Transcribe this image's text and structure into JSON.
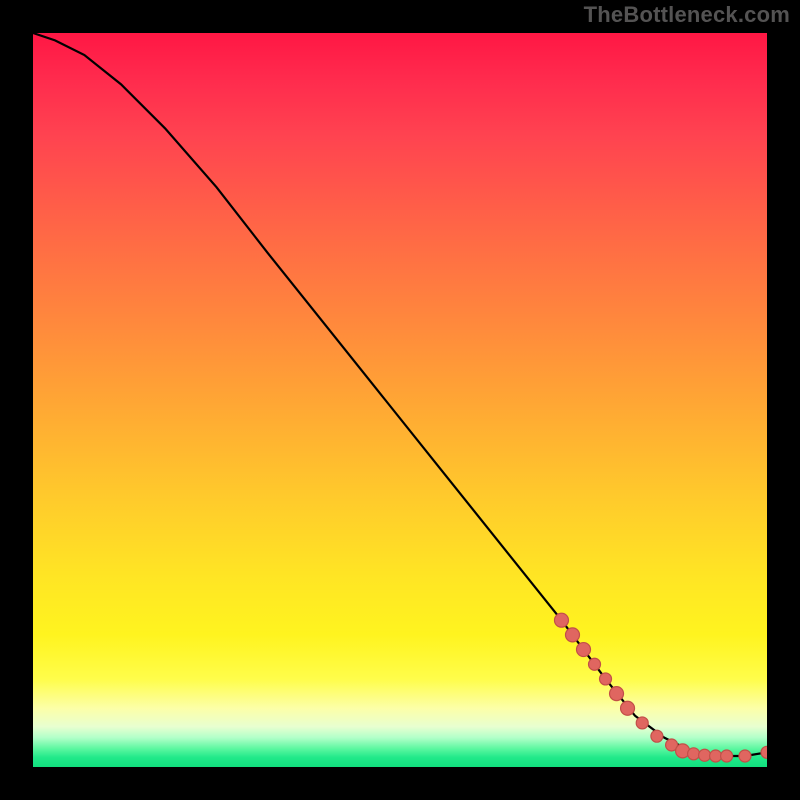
{
  "watermark": "TheBottleneck.com",
  "colors": {
    "background": "#000000",
    "curve": "#000000",
    "point_fill": "#e06660",
    "point_stroke": "#c24f48",
    "watermark": "#545353"
  },
  "chart_data": {
    "type": "line",
    "title": "",
    "xlabel": "",
    "ylabel": "",
    "xlim": [
      0,
      100
    ],
    "ylim": [
      0,
      100
    ],
    "series": [
      {
        "name": "bottleneck-curve",
        "x": [
          0,
          3,
          7,
          12,
          18,
          25,
          32,
          40,
          48,
          56,
          64,
          72,
          78,
          82,
          86,
          90,
          94,
          97,
          100
        ],
        "y": [
          100,
          99,
          97,
          93,
          87,
          79,
          70,
          60,
          50,
          40,
          30,
          20,
          12,
          7,
          4,
          2,
          1.5,
          1.5,
          2
        ]
      }
    ],
    "scatter": [
      {
        "name": "highlight-points",
        "points": [
          {
            "x": 72,
            "y": 20.0,
            "r": 7
          },
          {
            "x": 73.5,
            "y": 18.0,
            "r": 7
          },
          {
            "x": 75,
            "y": 16.0,
            "r": 7
          },
          {
            "x": 76.5,
            "y": 14.0,
            "r": 6
          },
          {
            "x": 78,
            "y": 12.0,
            "r": 6
          },
          {
            "x": 79.5,
            "y": 10.0,
            "r": 7
          },
          {
            "x": 81,
            "y": 8.0,
            "r": 7
          },
          {
            "x": 83,
            "y": 6.0,
            "r": 6
          },
          {
            "x": 85,
            "y": 4.2,
            "r": 6
          },
          {
            "x": 87,
            "y": 3.0,
            "r": 6
          },
          {
            "x": 88.5,
            "y": 2.2,
            "r": 7
          },
          {
            "x": 90,
            "y": 1.8,
            "r": 6
          },
          {
            "x": 91.5,
            "y": 1.6,
            "r": 6
          },
          {
            "x": 93,
            "y": 1.5,
            "r": 6
          },
          {
            "x": 94.5,
            "y": 1.5,
            "r": 6
          },
          {
            "x": 97,
            "y": 1.5,
            "r": 6
          },
          {
            "x": 100,
            "y": 2.0,
            "r": 6
          }
        ]
      }
    ]
  }
}
